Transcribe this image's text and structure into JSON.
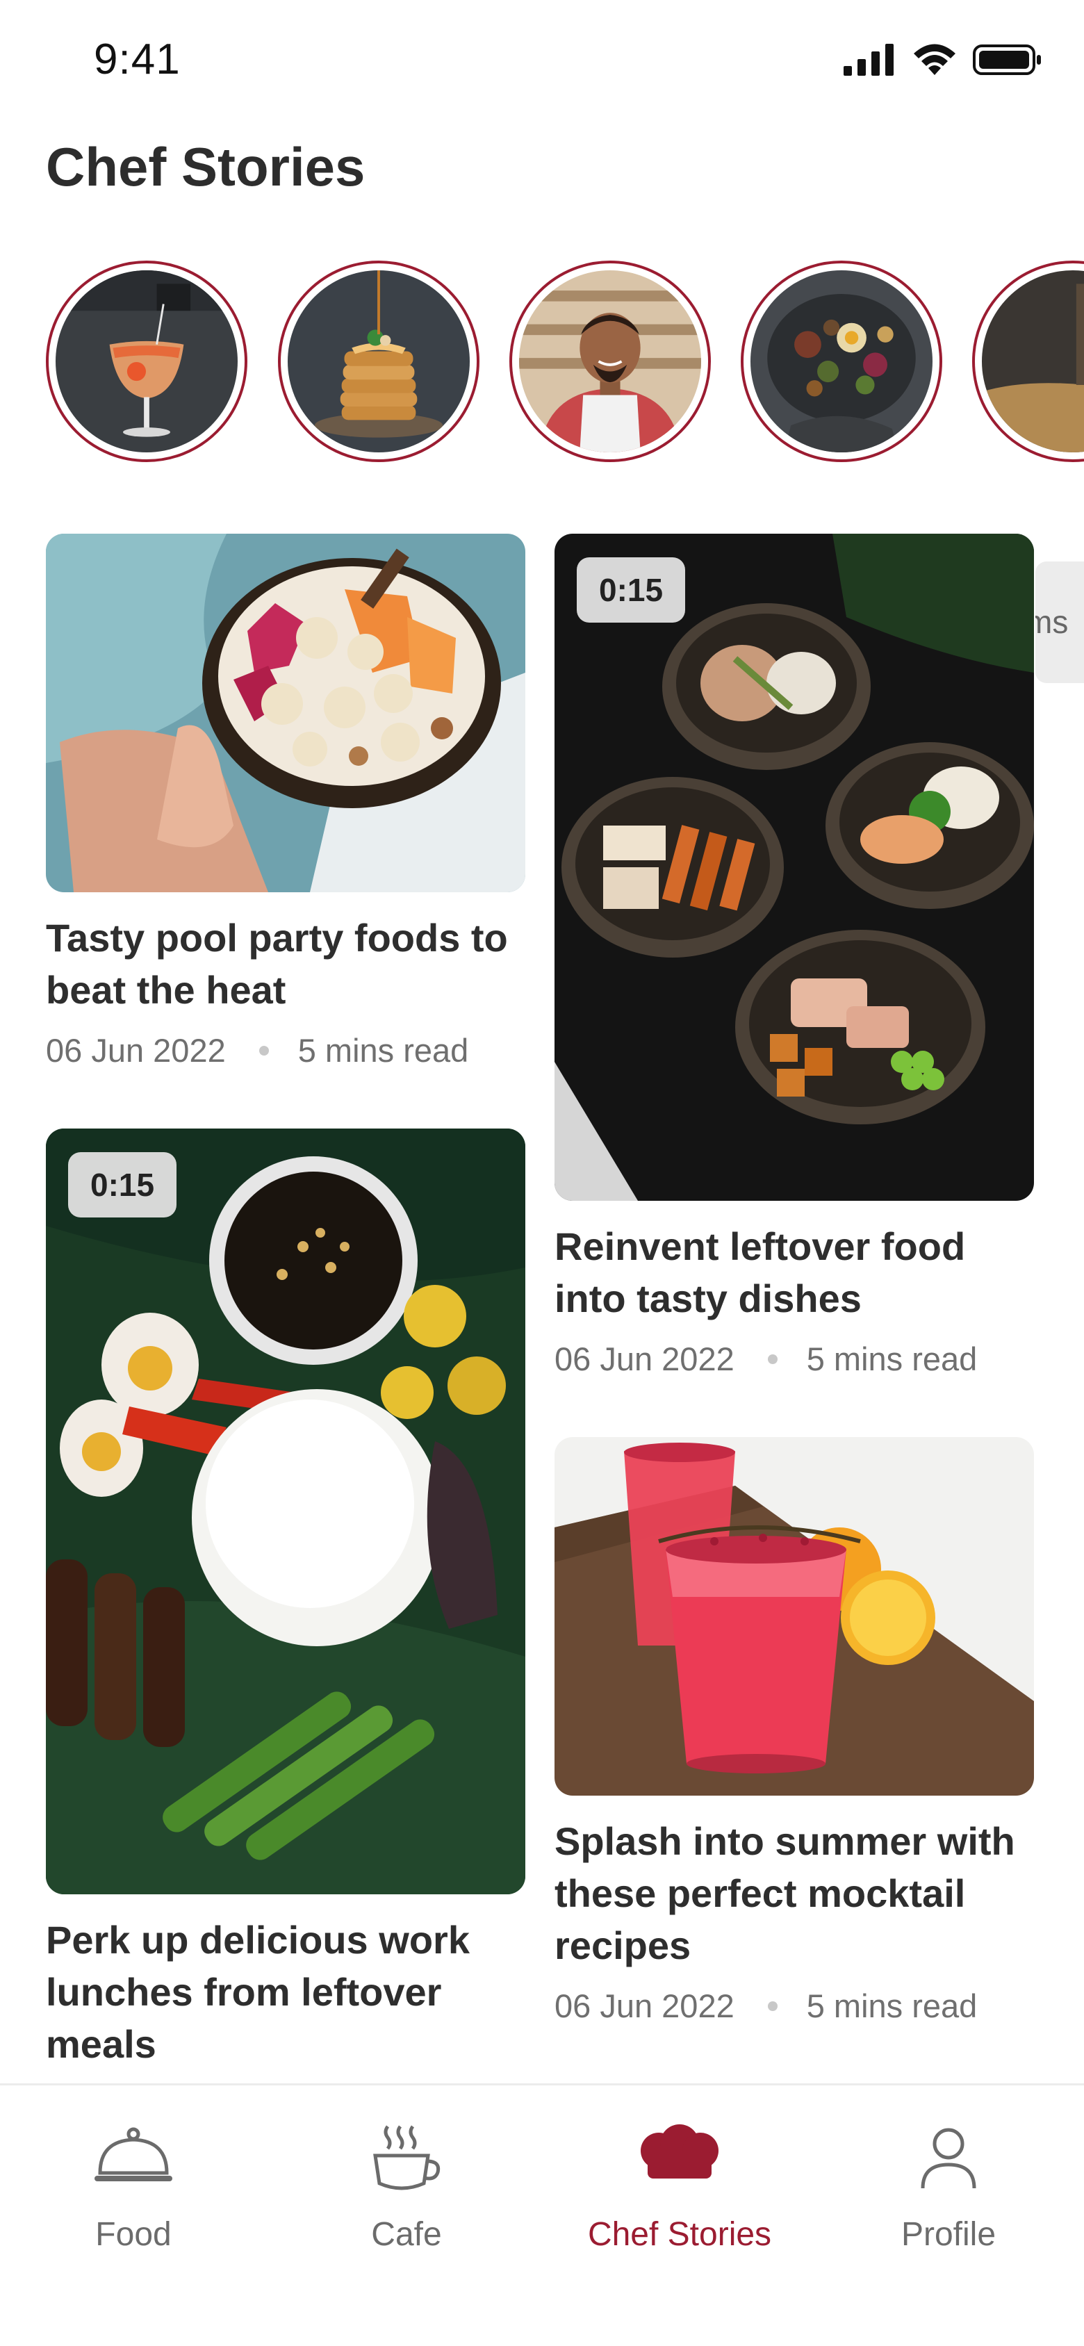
{
  "status_bar": {
    "time": "9:41"
  },
  "header": {
    "title": "Chef Stories"
  },
  "stories": [
    {
      "icon": "cocktail-story-thumbnail"
    },
    {
      "icon": "pancake-story-thumbnail"
    },
    {
      "icon": "chef-portrait-story-thumbnail"
    },
    {
      "icon": "platter-story-thumbnail"
    },
    {
      "icon": "partial-story-thumbnail"
    }
  ],
  "side_tab": {
    "label": "ms"
  },
  "cards": [
    {
      "title": "Tasty pool party foods to beat the heat",
      "date": "06 Jun 2022",
      "read_time": "5 mins read"
    },
    {
      "badge": "0:15",
      "title": "Reinvent leftover food into tasty dishes",
      "date": "06 Jun 2022",
      "read_time": "5 mins read"
    },
    {
      "badge": "0:15",
      "title": "Perk up delicious work lunches from leftover meals"
    },
    {
      "title": "Splash into summer with these perfect mocktail recipes",
      "date": "06 Jun 2022",
      "read_time": "5 mins read"
    }
  ],
  "bottom_nav": {
    "items": [
      {
        "label": "Food",
        "icon": "cloche-icon",
        "active": false
      },
      {
        "label": "Cafe",
        "icon": "coffee-cup-icon",
        "active": false
      },
      {
        "label": "Chef Stories",
        "icon": "chef-hat-icon",
        "active": true
      },
      {
        "label": "Profile",
        "icon": "person-icon",
        "active": false
      }
    ]
  },
  "colors": {
    "accent": "#9b1c31",
    "text_primary": "#2e2e2e",
    "text_secondary": "#6f6f6f"
  }
}
